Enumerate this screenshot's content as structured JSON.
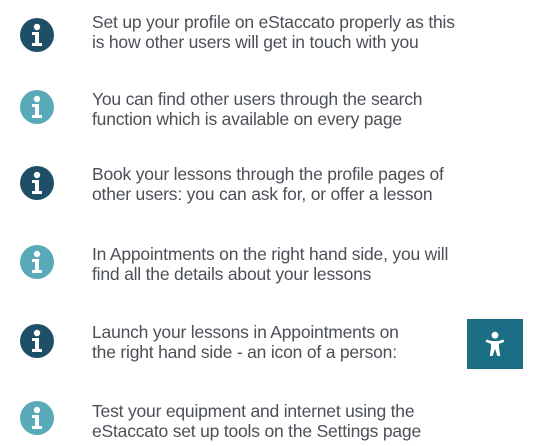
{
  "colors": {
    "dark_icon": "#1f4f66",
    "light_icon": "#58aab8",
    "badge": "#1b6e86"
  },
  "tips": [
    {
      "icon": "info-icon",
      "icon_variant": "dark",
      "lines": [
        "Set up your profile on eStaccato properly as this",
        "is how other users will get in touch with you"
      ]
    },
    {
      "icon": "info-icon",
      "icon_variant": "light",
      "lines": [
        "You can find other users through the search",
        "function which is available on every page"
      ]
    },
    {
      "icon": "info-icon",
      "icon_variant": "dark",
      "lines": [
        "Book your lessons through the profile pages of",
        "other users: you can ask for, or offer a lesson"
      ]
    },
    {
      "icon": "info-icon",
      "icon_variant": "light",
      "lines": [
        "In Appointments on the right hand side, you will",
        "find all the details about your lessons"
      ]
    },
    {
      "icon": "info-icon",
      "icon_variant": "dark",
      "lines": [
        "Launch your lessons in Appointments on",
        "the right hand side - an icon of a person:"
      ],
      "badge_icon": "person-icon"
    },
    {
      "icon": "info-icon",
      "icon_variant": "light",
      "lines": [
        "Test your equipment and internet using the",
        "eStaccato set up tools on the Settings page"
      ]
    }
  ]
}
